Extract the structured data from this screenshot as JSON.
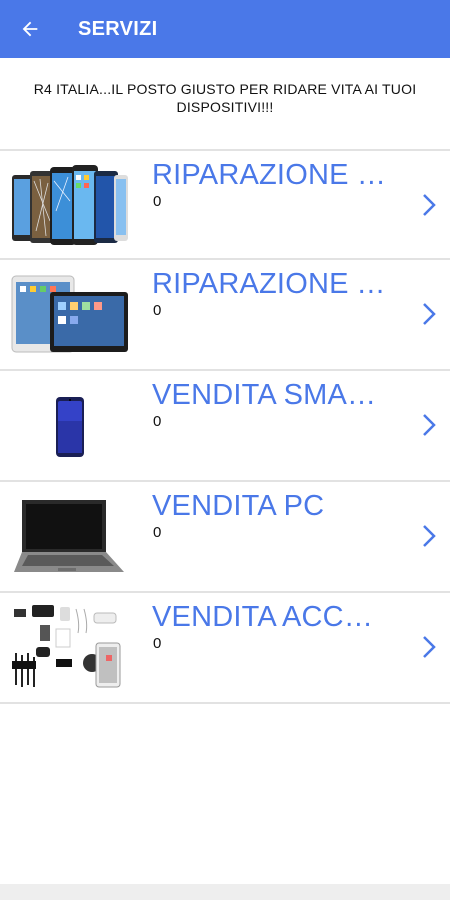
{
  "appbar": {
    "title": "SERVIZI",
    "back_icon": "arrow-left-icon",
    "color": "#4a78e8"
  },
  "tagline": "R4 ITALIA...IL POSTO GIUSTO PER RIDARE VITA AI TUOI DISPOSITIVI!!!",
  "services": [
    {
      "title": "RIPARAZIONE S...",
      "count": "0",
      "image": "smartphones-repair-image"
    },
    {
      "title": "RIPARAZIONE T...",
      "count": "0",
      "image": "tablets-repair-image"
    },
    {
      "title": "VENDITA SMAR...",
      "count": "0",
      "image": "smartphone-sale-image"
    },
    {
      "title": "VENDITA PC",
      "count": "0",
      "image": "laptop-sale-image"
    },
    {
      "title": "VENDITA ACCES...",
      "count": "0",
      "image": "accessories-sale-image"
    }
  ],
  "chevron_icon": "chevron-right-icon"
}
